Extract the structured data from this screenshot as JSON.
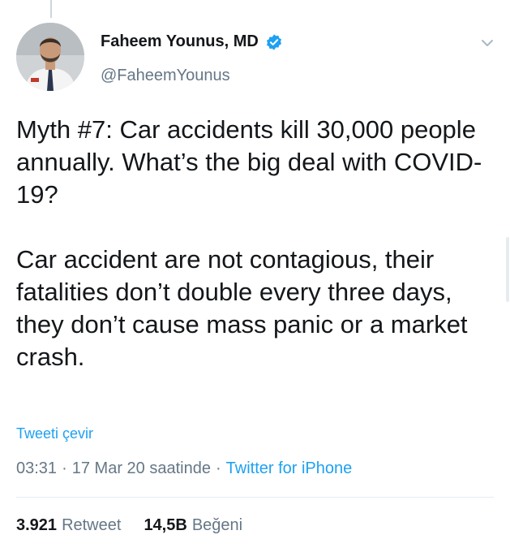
{
  "user": {
    "display_name": "Faheem Younus, MD",
    "handle": "@FaheemYounus",
    "verified": true,
    "avatar_icon": "profile-photo"
  },
  "tweet": {
    "text": "Myth #7: Car accidents kill 30,000 people annually. What’s the big deal with COVID-19?\n\nCar accident are not contagious, their fatalities don’t double every three days, they don’t cause mass panic or a market crash.",
    "translate_label": "Tweeti çevir",
    "time": "03:31",
    "separator1": "·",
    "date": "17 Mar 20 saatinde",
    "separator2": "·",
    "source": "Twitter for iPhone"
  },
  "stats": {
    "retweets_count": "3.921",
    "retweets_label": "Retweet",
    "likes_count": "14,5B",
    "likes_label": "Beğeni"
  },
  "colors": {
    "link": "#1da1f2",
    "muted": "#657786",
    "text": "#14171a"
  }
}
